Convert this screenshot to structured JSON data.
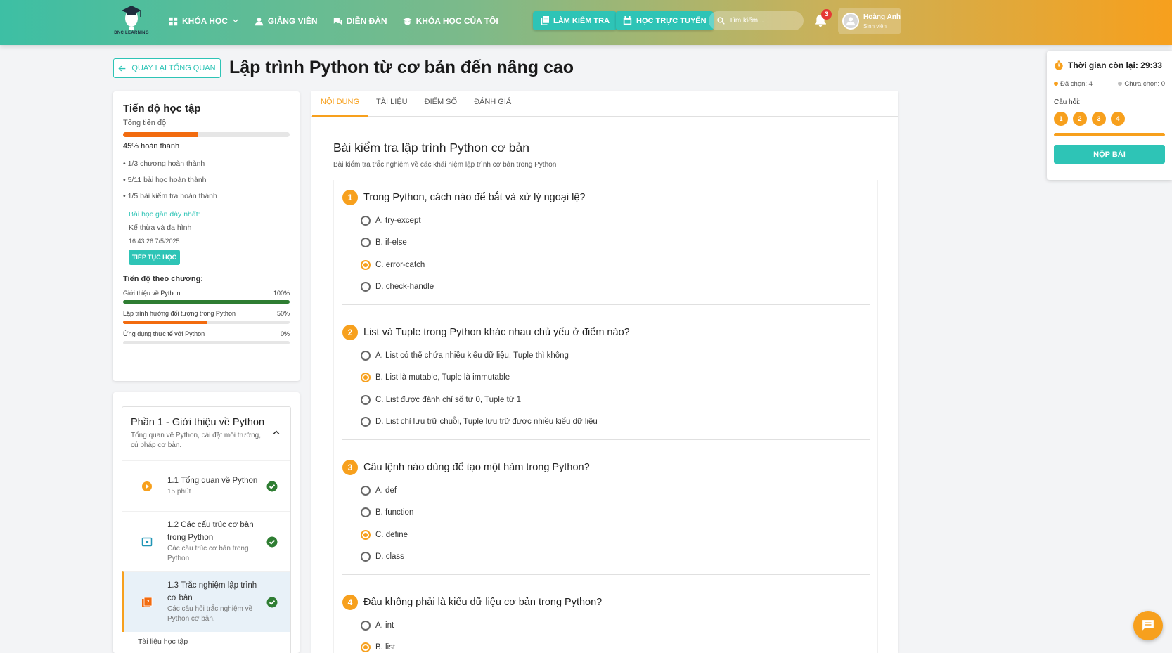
{
  "brand": {
    "logo_text": "DNC LEARNING"
  },
  "nav": [
    {
      "label": "KHÓA HỌC",
      "icon": "grid-icon"
    },
    {
      "label": "GIẢNG VIÊN",
      "icon": "person-icon"
    },
    {
      "label": "DIỄN ĐÀN",
      "icon": "forum-icon"
    },
    {
      "label": "KHÓA HỌC CỦA TÔI",
      "icon": "school-icon"
    }
  ],
  "header": {
    "test_btn": "LÀM KIỂM TRA",
    "online_btn": "HỌC TRỰC TUYẾN",
    "search_placeholder": "Tìm kiếm...",
    "notif_count": "3",
    "user_name": "Hoàng Anh",
    "user_role": "Sinh viên"
  },
  "page": {
    "back_label": "QUAY LẠI TỔNG QUAN",
    "title": "Lập trình Python từ cơ bản đến nâng cao"
  },
  "progress": {
    "title": "Tiến độ học tập",
    "total_label": "Tổng tiến độ",
    "percent": 45,
    "percent_text": "45% hoàn thành",
    "stats": [
      "• 1/3 chương hoàn thành",
      "• 5/11 bài học hoàn thành",
      "• 1/5 bài kiểm tra hoàn thành"
    ],
    "recent_label": "Bài học gần đây nhất:",
    "recent_lesson": "Kế thừa và đa hình",
    "recent_time": "16:43:26 7/5/2025",
    "continue_label": "TIẾP TỤC HỌC",
    "chapters_label": "Tiến độ theo chương:",
    "chapters": [
      {
        "name": "Giới thiệu về Python",
        "pct_text": "100%",
        "pct": 100
      },
      {
        "name": "Lập trình hướng đối tượng trong Python",
        "pct_text": "50%",
        "pct": 50
      },
      {
        "name": "Ứng dụng thực tế với Python",
        "pct_text": "0%",
        "pct": 0
      }
    ]
  },
  "section": {
    "title": "Phần 1 - Giới thiệu về Python",
    "desc": "Tổng quan về Python, cài đặt môi trường, cú pháp cơ bản.",
    "lessons": [
      {
        "title": "1.1 Tổng quan về Python",
        "meta": "15 phút",
        "icon": "play-circle-icon"
      },
      {
        "title": "1.2 Các cấu trúc cơ bản trong Python",
        "meta": "Các cấu trúc cơ bản trong Python",
        "icon": "video-icon"
      },
      {
        "title": "1.3 Trắc nghiệm lập trình cơ bản",
        "meta": "Các câu hỏi trắc nghiệm về Python cơ bản.",
        "icon": "quiz-icon"
      }
    ],
    "materials_label": "Tài liệu học tập"
  },
  "tabs": [
    "NỘI DUNG",
    "TÀI LIỆU",
    "ĐIỂM SỐ",
    "ĐÁNH GIÁ"
  ],
  "quiz": {
    "title": "Bài kiểm tra lập trình Python cơ bản",
    "desc": "Bài kiểm tra trắc nghiệm về các khái niệm lập trình cơ bản trong Python",
    "questions": [
      {
        "num": "1",
        "text": "Trong Python, cách nào để bắt và xử lý ngoại lệ?",
        "options": [
          "A. try-except",
          "B. if-else",
          "C. error-catch",
          "D. check-handle"
        ],
        "selected": 2
      },
      {
        "num": "2",
        "text": "List và Tuple trong Python khác nhau chủ yếu ở điểm nào?",
        "options": [
          "A. List có thể chứa nhiều kiểu dữ liệu, Tuple thì không",
          "B. List là mutable, Tuple là immutable",
          "C. List được đánh chỉ số từ 0, Tuple từ 1",
          "D. List chỉ lưu trữ chuỗi, Tuple lưu trữ được nhiều kiểu dữ liệu"
        ],
        "selected": 1
      },
      {
        "num": "3",
        "text": "Câu lệnh nào dùng để tạo một hàm trong Python?",
        "options": [
          "A. def",
          "B. function",
          "C. define",
          "D. class"
        ],
        "selected": 2
      },
      {
        "num": "4",
        "text": "Đâu không phải là kiểu dữ liệu cơ bản trong Python?",
        "options": [
          "A. int",
          "B. list"
        ],
        "selected": 1
      }
    ]
  },
  "timer": {
    "label": "Thời gian còn lại: 29:33",
    "selected_text": "Đã chọn: 4",
    "unselected_text": "Chưa chọn: 0",
    "questions_label": "Câu hỏi:",
    "numbers": [
      "1",
      "2",
      "3",
      "4"
    ],
    "submit_label": "NỘP BÀI"
  },
  "colors": {
    "accent": "#f7a01d",
    "teal": "#2ec4b6",
    "orange_bar": "#f26b0f",
    "green": "#2e7d32"
  }
}
